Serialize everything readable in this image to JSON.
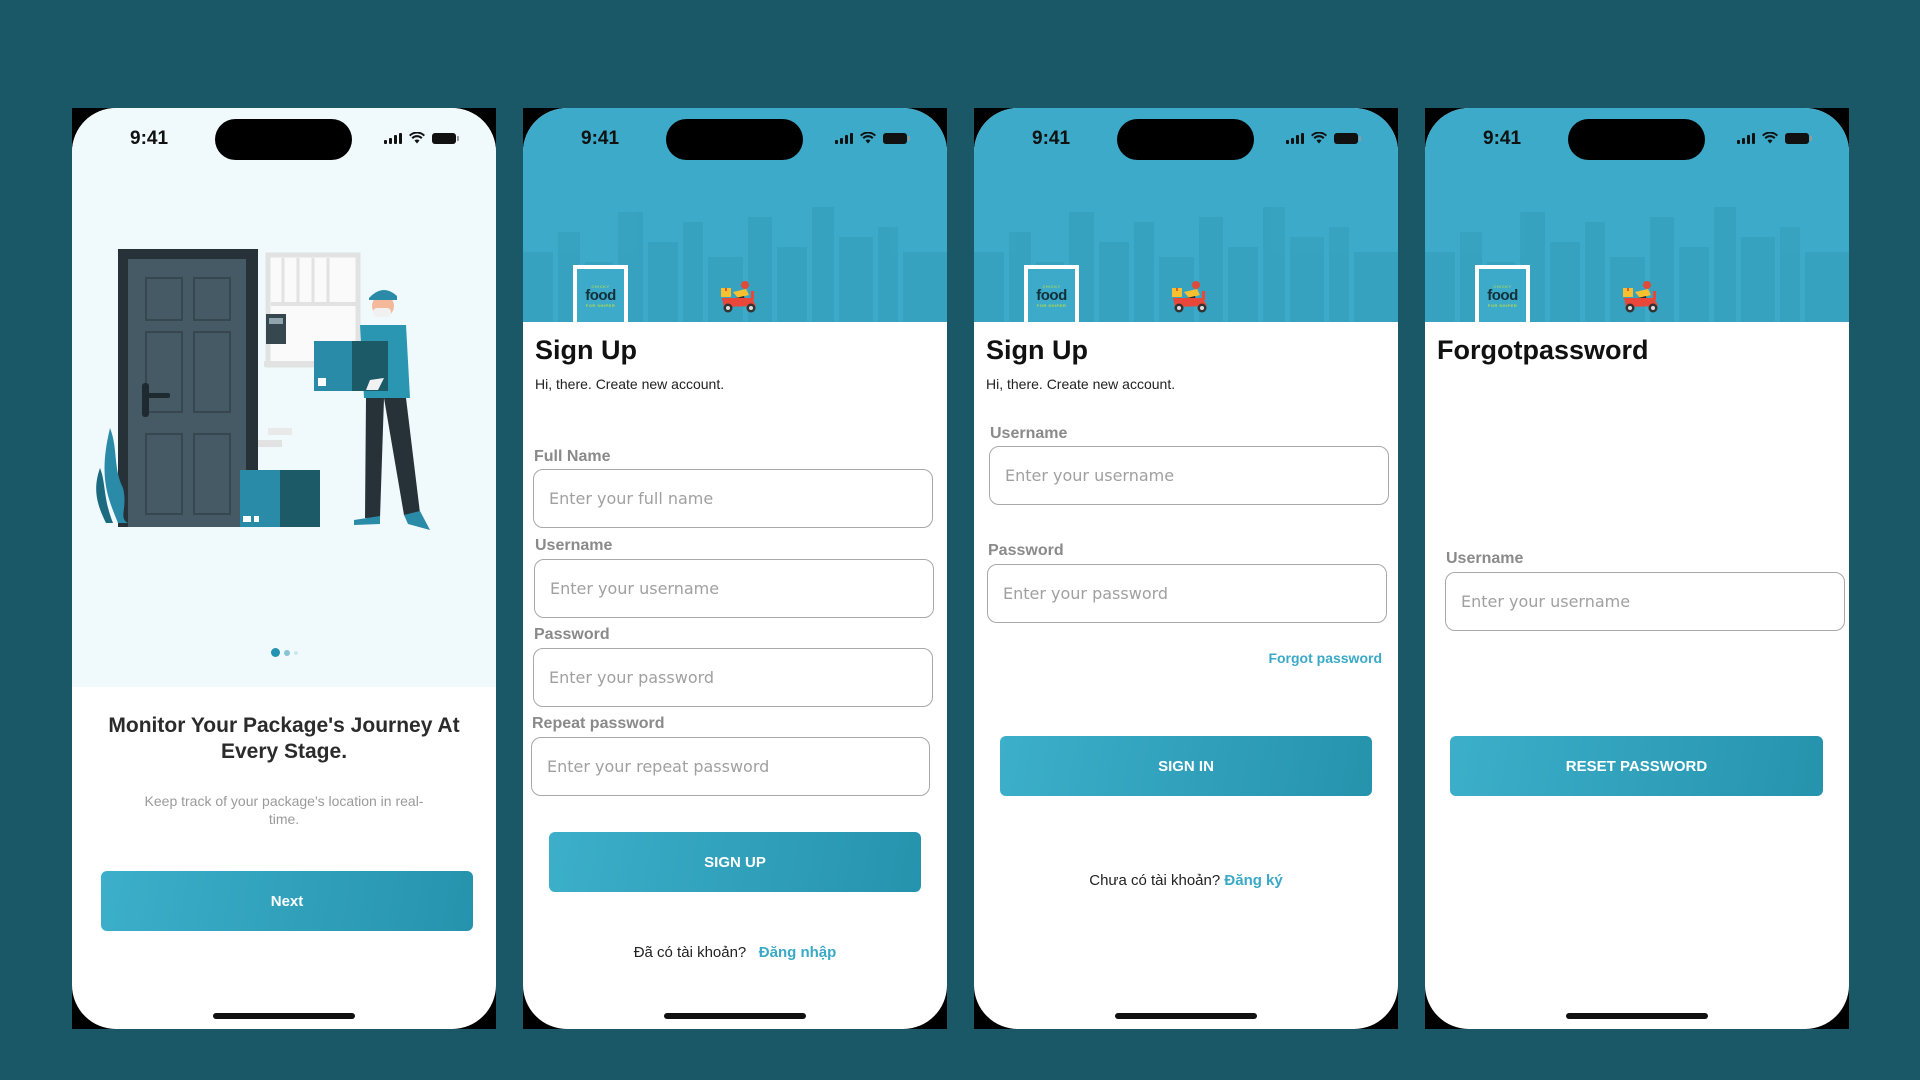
{
  "background_color": "#1b5867",
  "accent_color": "#3caac8",
  "status_bar": {
    "time": "9:41"
  },
  "onboarding": {
    "headline": "Monitor Your Package's Journey At Every Stage.",
    "subtext": "Keep track of your package's location in real-time.",
    "page_indicator": {
      "current": 1,
      "total": 3
    },
    "next_button": "Next",
    "illustration": "delivery-man-at-door-illustration"
  },
  "brand": {
    "logo_top": "CHICKY",
    "logo_main": "food",
    "logo_bottom": "FOR SHIPER",
    "mascot": "scooter-delivery-icon"
  },
  "signup": {
    "title": "Sign Up",
    "subtitle": "Hi, there. Create new account.",
    "fields": [
      {
        "label": "Full Name",
        "placeholder": "Enter your full name"
      },
      {
        "label": "Username",
        "placeholder": "Enter your username"
      },
      {
        "label": "Password",
        "placeholder": "Enter your password"
      },
      {
        "label": "Repeat password",
        "placeholder": "Enter your repeat password"
      }
    ],
    "submit": "SIGN UP",
    "footer_prompt": "Đã có tài khoản?",
    "footer_link": "Đăng nhập"
  },
  "signin": {
    "title": "Sign Up",
    "subtitle": "Hi, there. Create new account.",
    "fields": [
      {
        "label": "Username",
        "placeholder": "Enter your username"
      },
      {
        "label": "Password",
        "placeholder": "Enter your password"
      }
    ],
    "forgot_link": "Forgot password",
    "submit": "SIGN IN",
    "footer_prompt": "Chưa có tài khoản?",
    "footer_link": "Đăng ký"
  },
  "forgot": {
    "title": "Forgotpassword",
    "fields": [
      {
        "label": "Username",
        "placeholder": "Enter your username"
      }
    ],
    "submit": "RESET PASSWORD"
  }
}
